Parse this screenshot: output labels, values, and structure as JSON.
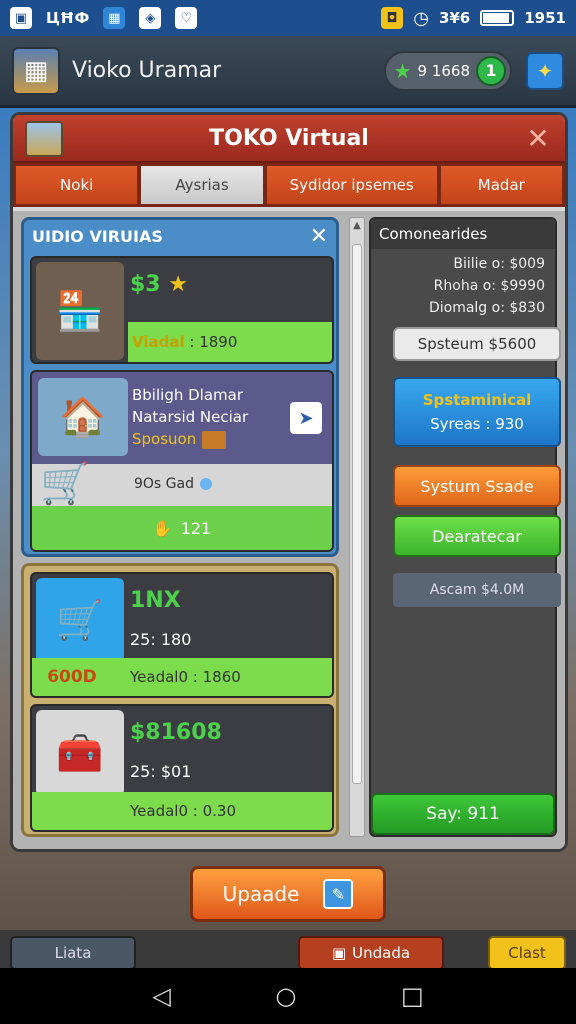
{
  "status_bar": {
    "left_text": "ЦĦФ",
    "right_text": "3¥6",
    "time": "1951",
    "battery_level": 0.85
  },
  "header": {
    "title": "Vioko Uramar",
    "currency_amount": "9 1668",
    "level": "1"
  },
  "panel": {
    "title": "TOKO Virtual",
    "tabs": [
      "Noki",
      "Aysrias",
      "Sydidor ipsemes",
      "Madar"
    ],
    "active_tab": 1
  },
  "group1": {
    "title": "UIDIO VIRUIAS",
    "card1": {
      "stat": "$3",
      "bar_label": "Viadal",
      "bar_value": "1890"
    },
    "card2": {
      "title_line1": "Bbiligh Dlamar",
      "title_line2": "Natarsid Neciar",
      "sub": "Sposuon",
      "status": "9Os Gad",
      "count": "121"
    }
  },
  "group2": {
    "card3": {
      "name": "1NX",
      "price": "25: 180",
      "badge": "600D",
      "bar_text": "Yeadal0 : 1860"
    },
    "card4": {
      "name": "$81608",
      "price": "25: $01",
      "bar_text": "Yeadal0 : 0.30"
    }
  },
  "right_panel": {
    "title": "Comonearides",
    "lines": [
      "Biilie o: $009",
      "Rhoha o: $9990",
      "Diomalg o: $830"
    ],
    "grey_button": "Spsteum $5600",
    "blue_button_line1": "Spstaminical",
    "blue_button_line2": "Syreas : 930",
    "orange_button": "Systum Ssade",
    "green_button": "Dearatecar",
    "assets": "Ascam $4.0M",
    "say_button": "Say: 911"
  },
  "upgrade_button": "Upaade",
  "bottom_buttons": {
    "left": "Liata",
    "middle": "Undada",
    "right": "Clast"
  }
}
